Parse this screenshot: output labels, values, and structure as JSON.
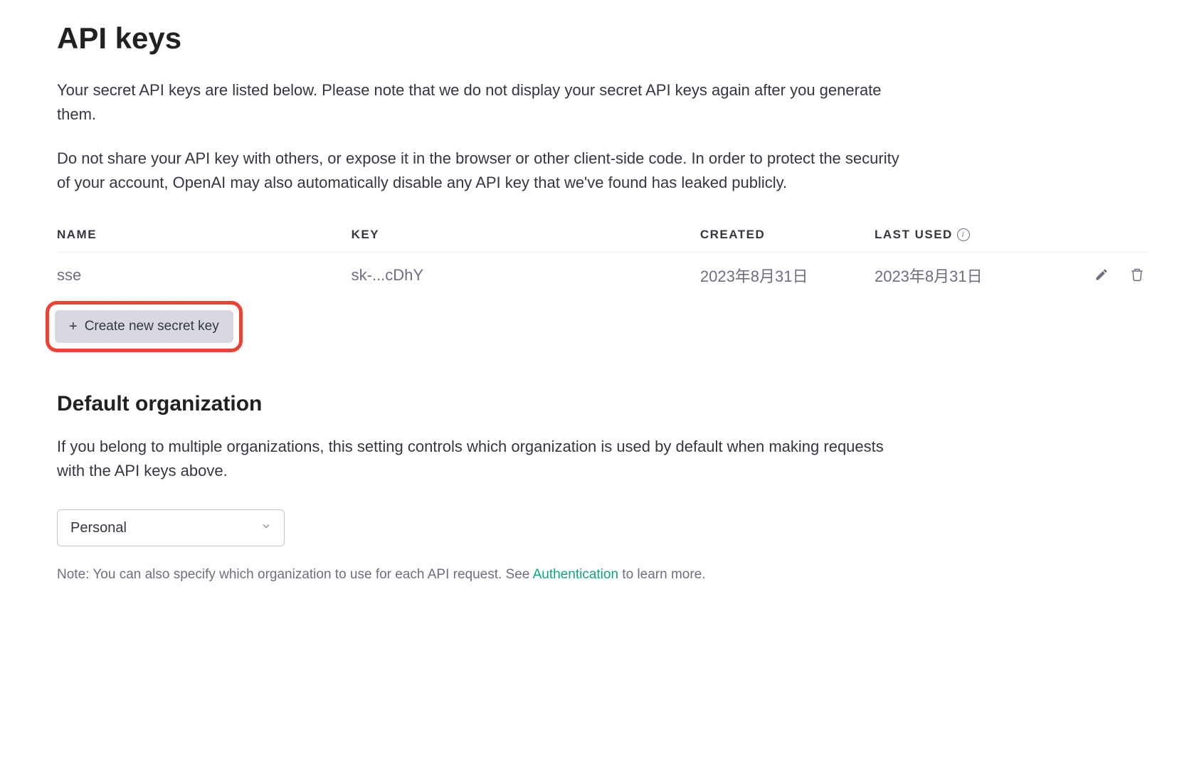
{
  "page": {
    "title": "API keys",
    "description1": "Your secret API keys are listed below. Please note that we do not display your secret API keys again after you generate them.",
    "description2": "Do not share your API key with others, or expose it in the browser or other client-side code. In order to protect the security of your account, OpenAI may also automatically disable any API key that we've found has leaked publicly."
  },
  "table": {
    "headers": {
      "name": "NAME",
      "key": "KEY",
      "created": "CREATED",
      "last_used": "LAST USED"
    },
    "rows": [
      {
        "name": "sse",
        "key": "sk-...cDhY",
        "created": "2023年8月31日",
        "last_used": "2023年8月31日"
      }
    ]
  },
  "create_button": {
    "label": "Create new secret key"
  },
  "default_org": {
    "title": "Default organization",
    "description": "If you belong to multiple organizations, this setting controls which organization is used by default when making requests with the API keys above.",
    "selected": "Personal",
    "note_prefix": "Note: You can also specify which organization to use for each API request. See ",
    "note_link": "Authentication",
    "note_suffix": " to learn more."
  }
}
